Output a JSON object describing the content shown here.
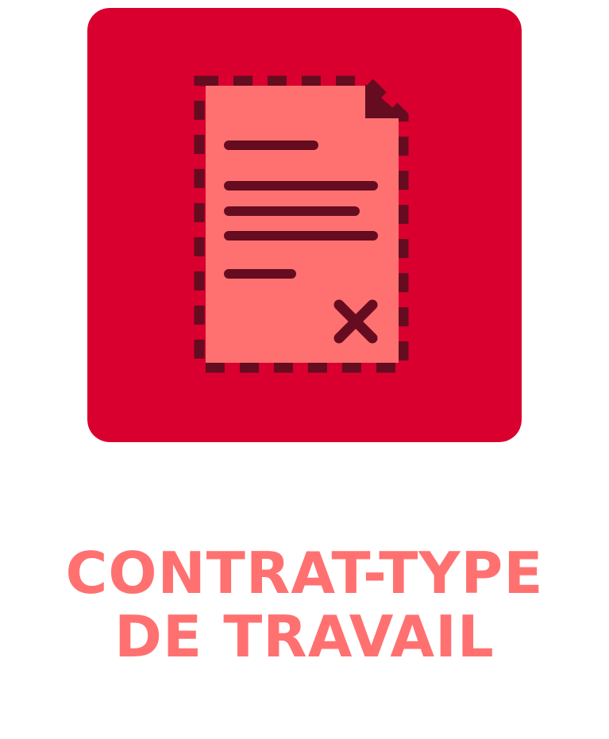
{
  "icon": {
    "name": "contract-document-icon",
    "colors": {
      "tile": "#D9002F",
      "paper": "#FF7170",
      "ink": "#650C20"
    }
  },
  "caption": {
    "line1": "CONTRAT-TYPE",
    "line2": "DE TRAVAIL",
    "color": "#FF7170"
  }
}
